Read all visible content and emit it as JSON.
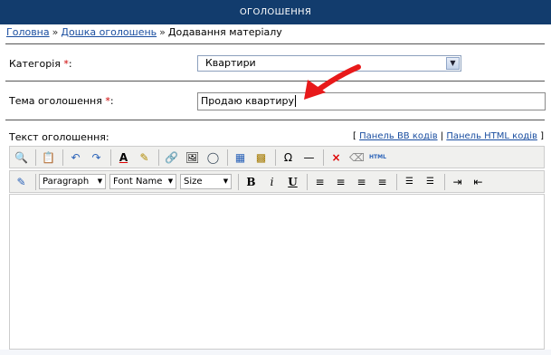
{
  "header": {
    "title": "ОГОЛОШЕННЯ"
  },
  "breadcrumb": {
    "home": "Головна",
    "separator": "»",
    "board": "Дошка оголошень",
    "current": "Додавання матеріалу"
  },
  "form": {
    "category": {
      "label": "Категорія",
      "required": "*",
      "suffix": ":",
      "value": "Квартири"
    },
    "subject": {
      "label": "Тема оголошення",
      "required": "*",
      "suffix": ":",
      "value": "Продаю квартиру"
    },
    "body": {
      "label": "Текст оголошення:"
    }
  },
  "panels": {
    "open_bracket": "[",
    "bb": "Панель BB кодів",
    "divider": "|",
    "html": "Панель HTML кодів",
    "close_bracket": "]"
  },
  "toolbar": {
    "paragraph": "Paragraph",
    "font_name": "Font Name",
    "size": "Size",
    "bold": "B",
    "italic": "i",
    "underline": "U",
    "html_label": "HTML"
  },
  "colors": {
    "header_bg": "#123c6d",
    "link": "#1a4ea0",
    "required": "#cc0000",
    "annotation_arrow": "#e8191a"
  }
}
